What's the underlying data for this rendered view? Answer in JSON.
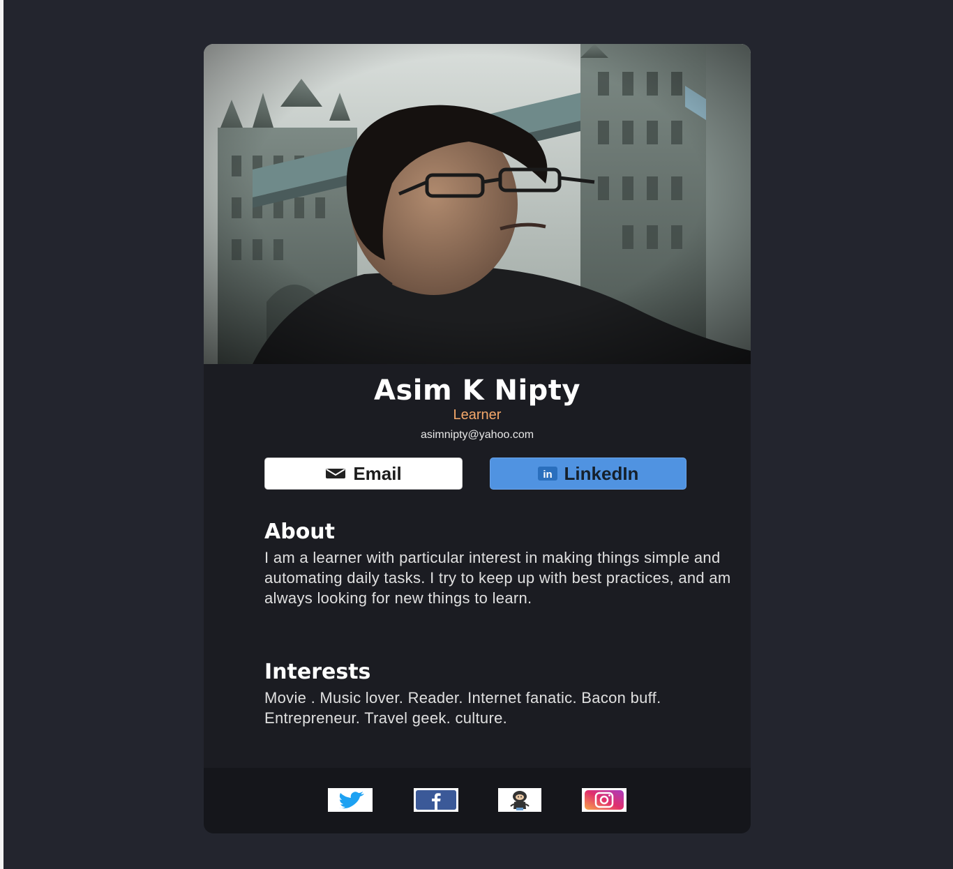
{
  "profile": {
    "name": "Asim K Nipty",
    "role": "Learner",
    "email": "asimnipty@yahoo.com"
  },
  "buttons": {
    "email_label": "Email",
    "linkedin_label": "LinkedIn"
  },
  "about": {
    "title": "About",
    "text": "I am a learner with particular interest in making things simple and automating daily tasks. I try to keep up with best practices, and am always looking for new things to learn."
  },
  "interests": {
    "title": "Interests",
    "text": "Movie . Music lover. Reader. Internet fanatic. Bacon buff. Entrepreneur. Travel geek. culture."
  },
  "social": [
    {
      "icon": "twitter-icon"
    },
    {
      "icon": "facebook-icon"
    },
    {
      "icon": "github-icon"
    },
    {
      "icon": "instagram-icon"
    }
  ],
  "colors": {
    "page_background": "#23252e",
    "card_background": "#1b1c22",
    "footer_background": "#15161b",
    "role_accent": "#f5a86a",
    "linkedin_button": "#5093e1"
  }
}
